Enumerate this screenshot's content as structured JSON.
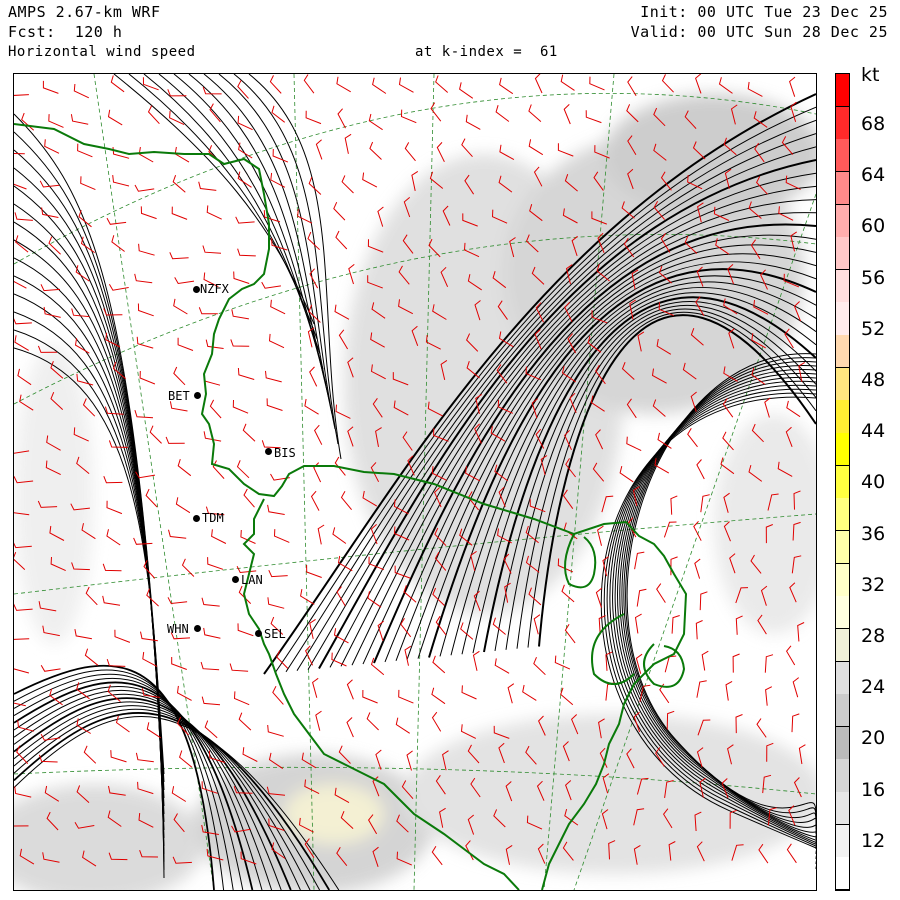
{
  "header": {
    "model": "AMPS 2.67-km WRF",
    "forecast": "Fcst:  120 h",
    "field": "Horizontal wind speed",
    "level": "at k-index =  61",
    "init": "Init: 00 UTC Tue 23 Dec 25",
    "valid": "Valid: 00 UTC Sun 28 Dec 25"
  },
  "colorbar": {
    "unit": "kt",
    "labels": [
      "68",
      "64",
      "60",
      "56",
      "52",
      "48",
      "44",
      "40",
      "36",
      "32",
      "28",
      "24",
      "20",
      "16",
      "12"
    ],
    "colors": [
      "#ff0000",
      "#ff2a2a",
      "#ff5a5a",
      "#ff8a8a",
      "#ffadad",
      "#ffc8c8",
      "#ffdede",
      "#ffecec",
      "#ffd9b0",
      "#ffe680",
      "#ffee33",
      "#ffff00",
      "#ffff40",
      "#ffff80",
      "#ffffaa",
      "#ffffc8",
      "#ffffe0",
      "#f0f0d8",
      "#e0e0e0",
      "#cccccc",
      "#bbbbbb",
      "#d6d6d6",
      "#e6e6e6",
      "#f2f2f2",
      "#ffffff"
    ]
  },
  "stations": [
    {
      "id": "nzfx",
      "label": "NZFX"
    },
    {
      "id": "bet",
      "label": "BET"
    },
    {
      "id": "bis",
      "label": "BIS"
    },
    {
      "id": "tdm",
      "label": "TDM"
    },
    {
      "id": "lan",
      "label": "LAN"
    },
    {
      "id": "whn",
      "label": "WHN"
    },
    {
      "id": "sel",
      "label": "SEL"
    }
  ]
}
